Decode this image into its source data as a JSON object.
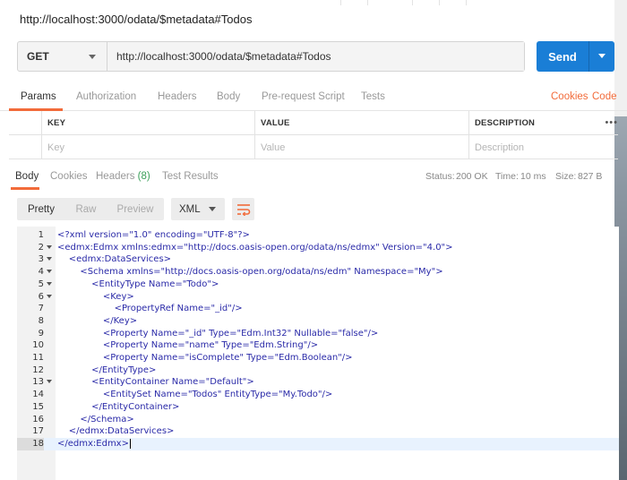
{
  "tab": {
    "title": "http://localhost:3000/odata/$metadata#Todos"
  },
  "request": {
    "method": "GET",
    "url": "http://localhost:3000/odata/$metadata#Todos",
    "send_label": "Send"
  },
  "request_tabs": {
    "params": "Params",
    "authorization": "Authorization",
    "headers": "Headers",
    "body": "Body",
    "prerequest": "Pre-request Script",
    "tests": "Tests",
    "cookies": "Cookies",
    "code": "Code"
  },
  "params_table": {
    "headers": [
      "KEY",
      "VALUE",
      "DESCRIPTION"
    ],
    "placeholders": [
      "Key",
      "Value",
      "Description"
    ],
    "more": "•••"
  },
  "response_tabs": {
    "body": "Body",
    "cookies": "Cookies",
    "headers": "Headers",
    "headers_count": "(8)",
    "test_results": "Test Results"
  },
  "status": {
    "status_label": "Status:",
    "status_value": "200 OK",
    "time_label": "Time:",
    "time_value": "10 ms",
    "size_label": "Size:",
    "size_value": "827 B"
  },
  "view_modes": [
    "Pretty",
    "Raw",
    "Preview"
  ],
  "format": "XML",
  "icons": {
    "wrap": "wrap-lines-icon",
    "method_caret": "chevron-down-icon",
    "send_caret": "chevron-down-icon"
  },
  "colors": {
    "accent": "#f26b3a",
    "send": "#1a7ed6",
    "success": "#3ca05a",
    "code": "#2a2aa8"
  },
  "code_lines": [
    {
      "n": "1",
      "fold": false,
      "text": "<?xml version=\"1.0\" encoding=\"UTF-8\"?>"
    },
    {
      "n": "2",
      "fold": true,
      "text": "<edmx:Edmx xmlns:edmx=\"http://docs.oasis-open.org/odata/ns/edmx\" Version=\"4.0\">"
    },
    {
      "n": "3",
      "fold": true,
      "text": "    <edmx:DataServices>"
    },
    {
      "n": "4",
      "fold": true,
      "text": "        <Schema xmlns=\"http://docs.oasis-open.org/odata/ns/edm\" Namespace=\"My\">"
    },
    {
      "n": "5",
      "fold": true,
      "text": "            <EntityType Name=\"Todo\">"
    },
    {
      "n": "6",
      "fold": true,
      "text": "                <Key>"
    },
    {
      "n": "7",
      "fold": false,
      "text": "                    <PropertyRef Name=\"_id\"/>"
    },
    {
      "n": "8",
      "fold": false,
      "text": "                </Key>"
    },
    {
      "n": "9",
      "fold": false,
      "text": "                <Property Name=\"_id\" Type=\"Edm.Int32\" Nullable=\"false\"/>"
    },
    {
      "n": "10",
      "fold": false,
      "text": "                <Property Name=\"name\" Type=\"Edm.String\"/>"
    },
    {
      "n": "11",
      "fold": false,
      "text": "                <Property Name=\"isComplete\" Type=\"Edm.Boolean\"/>"
    },
    {
      "n": "12",
      "fold": false,
      "text": "            </EntityType>"
    },
    {
      "n": "13",
      "fold": true,
      "text": "            <EntityContainer Name=\"Default\">"
    },
    {
      "n": "14",
      "fold": false,
      "text": "                <EntitySet Name=\"Todos\" EntityType=\"My.Todo\"/>"
    },
    {
      "n": "15",
      "fold": false,
      "text": "            </EntityContainer>"
    },
    {
      "n": "16",
      "fold": false,
      "text": "        </Schema>"
    },
    {
      "n": "17",
      "fold": false,
      "text": "    </edmx:DataServices>"
    },
    {
      "n": "18",
      "fold": false,
      "text": "</edmx:Edmx>"
    }
  ]
}
